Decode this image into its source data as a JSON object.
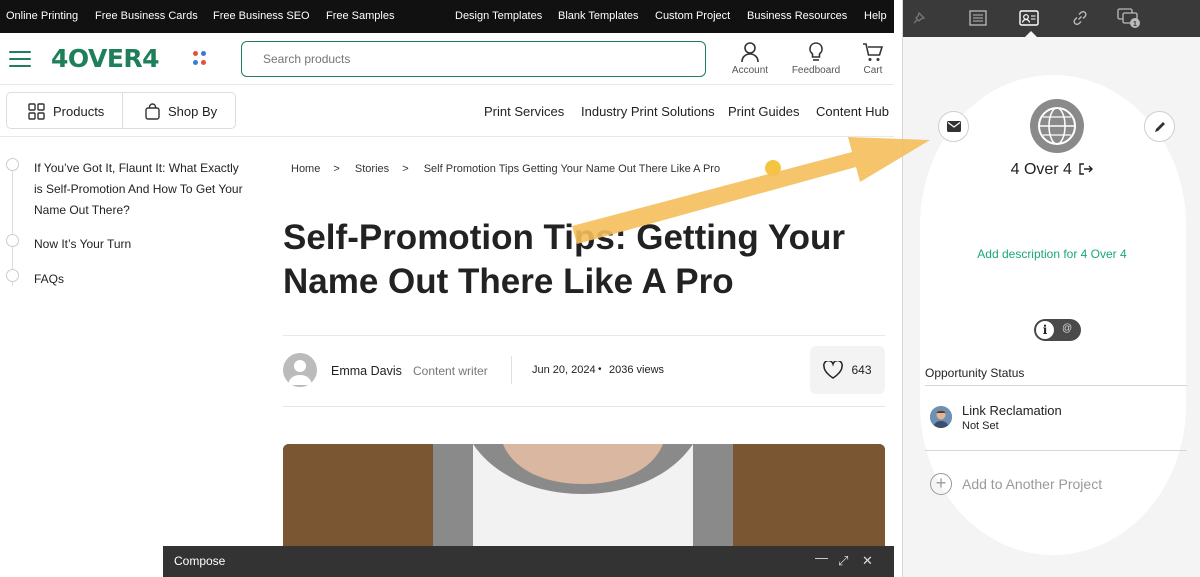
{
  "topnav": {
    "left": [
      "Online Printing",
      "Free Business Cards",
      "Free Business SEO",
      "Free Samples"
    ],
    "right": [
      "Design Templates",
      "Blank Templates",
      "Custom Project",
      "Business Resources",
      "Help"
    ]
  },
  "header": {
    "logo": "4OVER4",
    "search_placeholder": "Search products",
    "account": "Account",
    "feedback": "Feedboard",
    "cart": "Cart"
  },
  "subnav": {
    "products": "Products",
    "shop_by": "Shop By",
    "links": [
      "Print Services",
      "Industry Print Solutions",
      "Print Guides",
      "Content Hub"
    ]
  },
  "toc": [
    "If You’ve Got It, Flaunt It: What Exactly is Self-Promotion And How To Get Your Name Out There?",
    "Now It’s Your Turn",
    "FAQs"
  ],
  "breadcrumb": {
    "home": "Home",
    "sep": ">",
    "stories": "Stories",
    "current": "Self Promotion Tips Getting Your Name Out There Like A Pro"
  },
  "article": {
    "title": "Self-Promotion Tips: Getting Your Name Out There Like A Pro",
    "author": "Emma Davis",
    "role": "Content writer",
    "date": "Jun 20, 2024",
    "dot": "•",
    "views": "2036 views",
    "likes": "643"
  },
  "compose": {
    "title": "Compose"
  },
  "panel": {
    "contact_name": "4 Over 4",
    "add_description": "Add description for 4 Over 4",
    "toggle_i": "i",
    "toggle_at": "@",
    "opportunity_status_label": "Opportunity Status",
    "opportunity_name": "Link Reclamation",
    "opportunity_status": "Not Set",
    "add_project": "Add to Another Project",
    "plus": "+",
    "badge_count": "1"
  },
  "colors": {
    "brand_green": "#1e7f5a",
    "link_green": "#19a974",
    "arrow": "#f5be5a"
  }
}
